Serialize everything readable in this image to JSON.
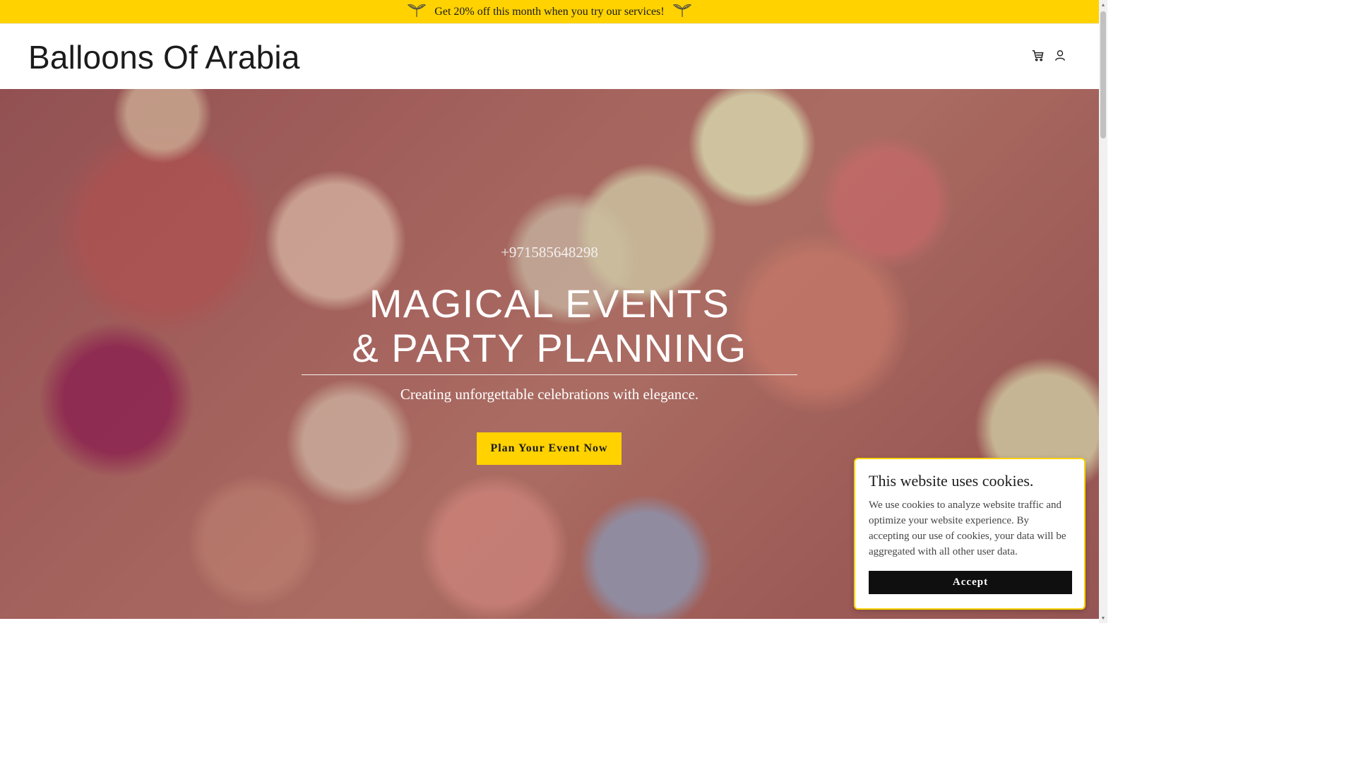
{
  "promo": {
    "text": "Get 20% off this month when you try our services!",
    "icon_left": "leaf-sprout-icon",
    "icon_right": "leaf-sprout-icon"
  },
  "header": {
    "site_title": "Balloons Of Arabia",
    "icons": [
      "cart-icon",
      "account-icon"
    ]
  },
  "hero": {
    "phone": "+971585648298",
    "title": "MAGICAL EVENTS & PARTY PLANNING",
    "subtitle": "Creating unforgettable celebrations with elegance.",
    "cta_label": "Plan Your Event Now"
  },
  "cookie_banner": {
    "title": "This website uses cookies.",
    "text": "We use cookies to analyze website traffic and optimize your website experience. By accepting our use of cookies, your data will be aggregated with all other user data.",
    "accept_label": "Accept"
  },
  "colors": {
    "accent": "#FFD200",
    "text_dark": "#1b1b1b",
    "button_dark": "#0f0f0f"
  }
}
